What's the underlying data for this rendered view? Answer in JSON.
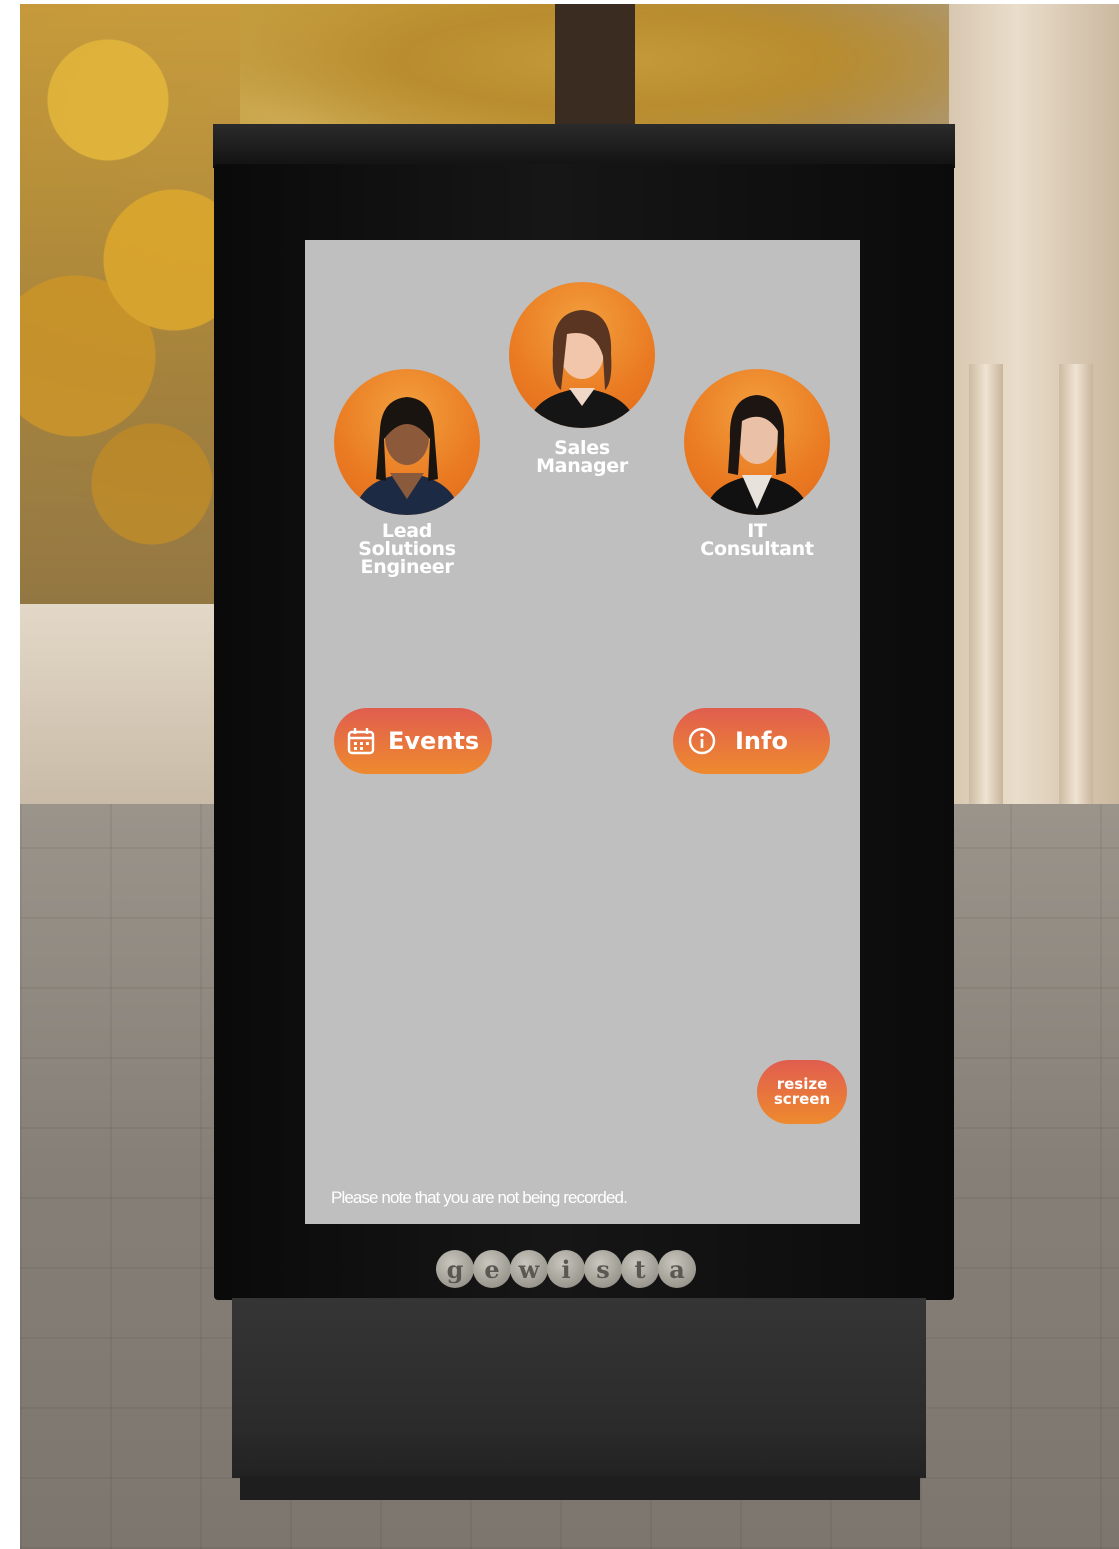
{
  "screen": {
    "profiles": [
      {
        "role": "Lead\nSolutions\nEngineer",
        "icon": "person-photo-icon"
      },
      {
        "role": "Sales\nManager",
        "icon": "person-photo-icon"
      },
      {
        "role": "IT\nConsultant",
        "icon": "person-photo-icon"
      }
    ],
    "buttons": {
      "events": {
        "label": "Events",
        "icon": "calendar-icon"
      },
      "info": {
        "label": "Info",
        "icon": "info-circle-icon"
      },
      "resize_line1": "resize",
      "resize_line2": "screen"
    },
    "notice": "Please note that you are not being recorded."
  },
  "brand": {
    "letters": [
      "g",
      "e",
      "w",
      "i",
      "s",
      "t",
      "a"
    ]
  },
  "colors": {
    "screen_bg": "#bfbfbf",
    "accent_top": "#e05d4f",
    "accent_bottom": "#ee8a2e",
    "avatar_orange": "#ea7a22"
  }
}
